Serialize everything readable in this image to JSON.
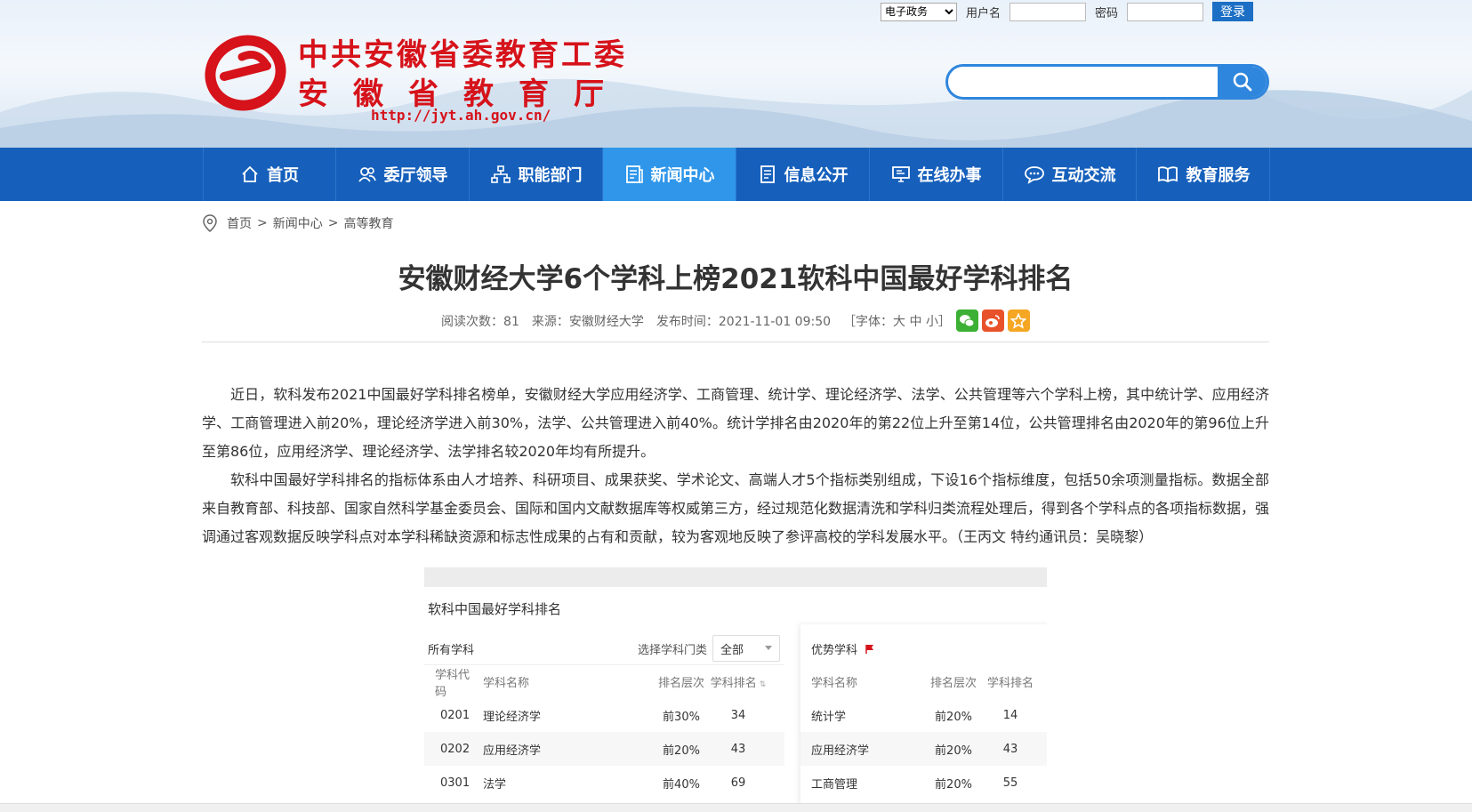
{
  "header": {
    "logo_line1": "中共安徽省委教育工委",
    "logo_line2": "安徽省教育厅",
    "logo_url": "http://jyt.ah.gov.cn/",
    "login": {
      "select_value": "电子政务",
      "username_label": "用户名",
      "password_label": "密码",
      "login_button": "登录"
    },
    "search": {
      "placeholder": ""
    }
  },
  "nav": {
    "items": [
      {
        "label": "首页",
        "icon": "home-icon"
      },
      {
        "label": "委厅领导",
        "icon": "users-icon"
      },
      {
        "label": "职能部门",
        "icon": "org-chart-icon"
      },
      {
        "label": "新闻中心",
        "icon": "news-icon",
        "active": true
      },
      {
        "label": "信息公开",
        "icon": "document-icon"
      },
      {
        "label": "在线办事",
        "icon": "monitor-icon"
      },
      {
        "label": "互动交流",
        "icon": "chat-icon"
      },
      {
        "label": "教育服务",
        "icon": "book-icon"
      }
    ],
    "active_color": "#2f96ea",
    "bar_color": "#1660bc"
  },
  "breadcrumb": {
    "home": "首页",
    "level1": "新闻中心",
    "level2": "高等教育",
    "sep": ">"
  },
  "article": {
    "title": "安徽财经大学6个学科上榜2021软科中国最好学科排名",
    "meta": {
      "reads": "阅读次数：81",
      "source": "来源：安徽财经大学",
      "published": "发布时间：2021-11-01 09:50",
      "font_size": "［字体：大 中 小］"
    },
    "paragraphs": [
      "近日，软科发布2021中国最好学科排名榜单，安徽财经大学应用经济学、工商管理、统计学、理论经济学、法学、公共管理等六个学科上榜，其中统计学、应用经济学、工商管理进入前20%，理论经济学进入前30%，法学、公共管理进入前40%。统计学排名由2020年的第22位上升至第14位，公共管理排名由2020年的第96位上升至第86位，应用经济学、理论经济学、法学排名较2020年均有所提升。",
      "软科中国最好学科排名的指标体系由人才培养、科研项目、成果获奖、学术论文、高端人才5个指标类别组成，下设16个指标维度，包括50余项测量指标。数据全部来自教育部、科技部、国家自然科学基金委员会、国际和国内文献数据库等权威第三方，经过规范化数据清洗和学科归类流程处理后，得到各个学科点的各项指标数据，强调通过客观数据反映学科点对本学科稀缺资源和标志性成果的占有和贡献，较为客观地反映了参评高校的学科发展水平。（王丙文 特约通讯员：吴晓黎）"
    ]
  },
  "ranking_image": {
    "title": "软科中国最好学科排名",
    "left": {
      "title": "所有学科",
      "filter_label": "选择学科门类",
      "filter_value": "全部",
      "headers": {
        "code": "学科代码",
        "name": "学科名称",
        "level": "排名层次",
        "rank": "学科排名"
      },
      "rows": [
        {
          "code": "0201",
          "name": "理论经济学",
          "level": "前30%",
          "rank": "34"
        },
        {
          "code": "0202",
          "name": "应用经济学",
          "level": "前20%",
          "rank": "43"
        },
        {
          "code": "0301",
          "name": "法学",
          "level": "前40%",
          "rank": "69"
        }
      ]
    },
    "right": {
      "title": "优势学科",
      "headers": {
        "name": "学科名称",
        "level": "排名层次",
        "rank": "学科排名"
      },
      "rows": [
        {
          "name": "统计学",
          "level": "前20%",
          "rank": "14"
        },
        {
          "name": "应用经济学",
          "level": "前20%",
          "rank": "43"
        },
        {
          "name": "工商管理",
          "level": "前20%",
          "rank": "55"
        }
      ]
    }
  }
}
